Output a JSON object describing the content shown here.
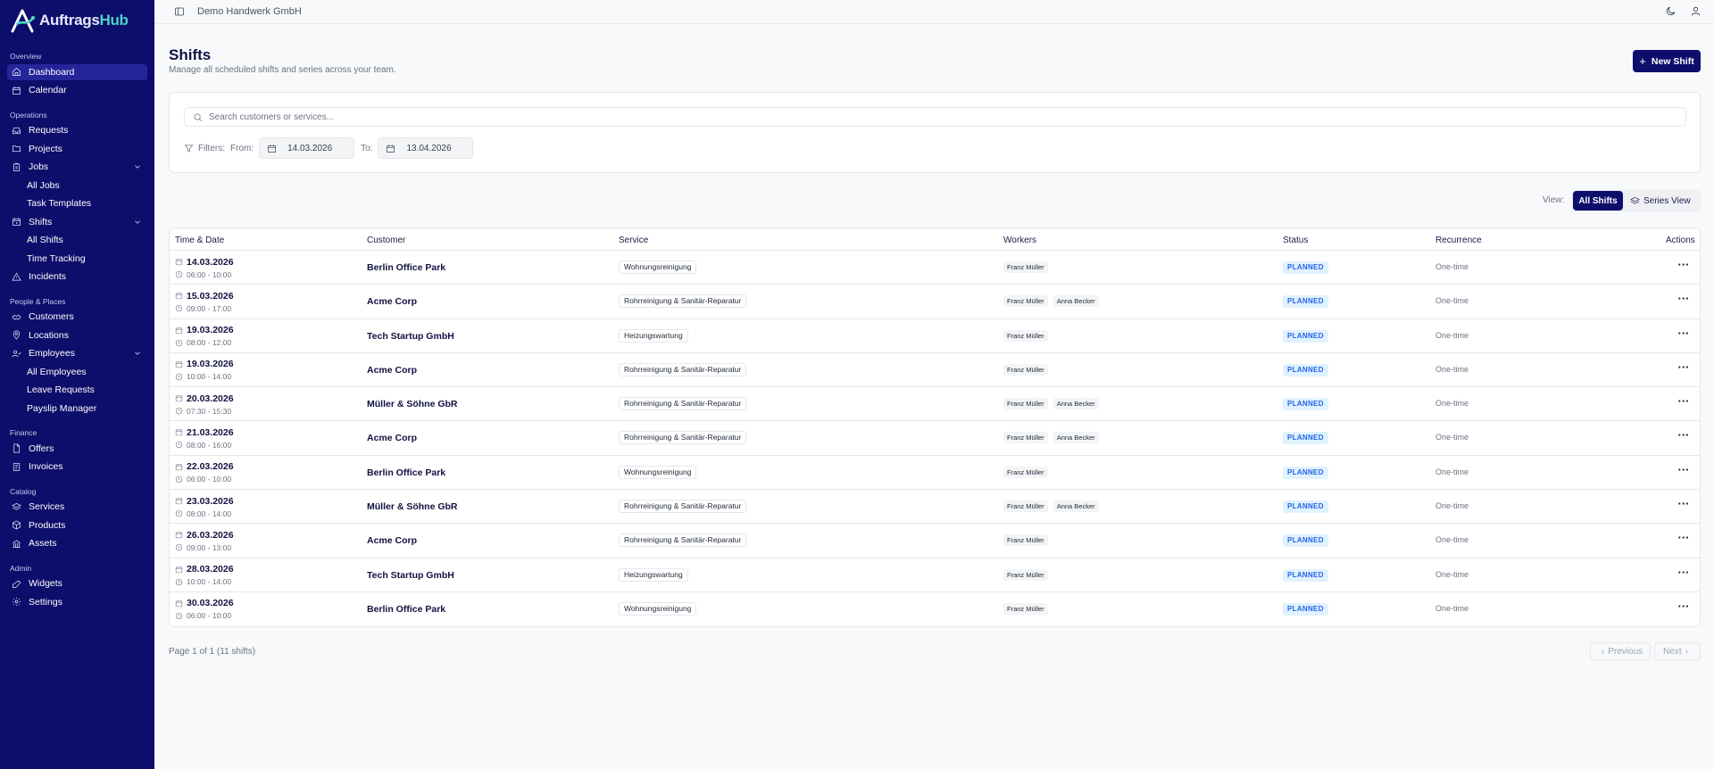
{
  "app": {
    "logo_main": "Auftrags",
    "logo_accent": "Hub",
    "company": "Demo Handwerk GmbH"
  },
  "sidebar": {
    "sections": {
      "overview": "Overview",
      "operations": "Operations",
      "people": "People & Places",
      "finance": "Finance",
      "catalog": "Catalog",
      "admin": "Admin"
    },
    "items": {
      "dashboard": "Dashboard",
      "calendar": "Calendar",
      "requests": "Requests",
      "projects": "Projects",
      "jobs": "Jobs",
      "all_jobs": "All Jobs",
      "task_templates": "Task Templates",
      "shifts": "Shifts",
      "all_shifts": "All Shifts",
      "time_tracking": "Time Tracking",
      "incidents": "Incidents",
      "customers": "Customers",
      "locations": "Locations",
      "employees": "Employees",
      "all_employees": "All Employees",
      "leave_requests": "Leave Requests",
      "payslip_manager": "Payslip Manager",
      "offers": "Offers",
      "invoices": "Invoices",
      "services": "Services",
      "products": "Products",
      "assets": "Assets",
      "widgets": "Widgets",
      "settings": "Settings"
    }
  },
  "header": {
    "title": "Shifts",
    "subtitle": "Manage all scheduled shifts and series across your team.",
    "new_button": "New Shift"
  },
  "filters": {
    "search_placeholder": "Search customers or services...",
    "filters_label": "Filters:",
    "from_label": "From:",
    "from_value": "14.03.2026",
    "to_label": "To:",
    "to_value": "13.04.2026"
  },
  "view": {
    "label": "View:",
    "all_shifts": "All Shifts",
    "series_view": "Series View"
  },
  "table": {
    "headers": {
      "time_date": "Time & Date",
      "customer": "Customer",
      "service": "Service",
      "workers": "Workers",
      "status": "Status",
      "recurrence": "Recurrence",
      "actions": "Actions"
    },
    "rows": [
      {
        "date": "14.03.2026",
        "time": "06:00 - 10:00",
        "customer": "Berlin Office Park",
        "service": "Wohnungsreinigung",
        "worker1": "Franz Müller",
        "worker2": "",
        "status": "PLANNED",
        "recurrence": "One-time"
      },
      {
        "date": "15.03.2026",
        "time": "09:00 - 17:00",
        "customer": "Acme Corp",
        "service": "Rohrreinigung & Sanitär-Reparatur",
        "worker1": "Franz Müller",
        "worker2": "Anna Becker",
        "status": "PLANNED",
        "recurrence": "One-time"
      },
      {
        "date": "19.03.2026",
        "time": "08:00 - 12:00",
        "customer": "Tech Startup GmbH",
        "service": "Heizungswartung",
        "worker1": "Franz Müller",
        "worker2": "",
        "status": "PLANNED",
        "recurrence": "One-time"
      },
      {
        "date": "19.03.2026",
        "time": "10:00 - 14:00",
        "customer": "Acme Corp",
        "service": "Rohrreinigung & Sanitär-Reparatur",
        "worker1": "Franz Müller",
        "worker2": "",
        "status": "PLANNED",
        "recurrence": "One-time"
      },
      {
        "date": "20.03.2026",
        "time": "07:30 - 15:30",
        "customer": "Müller & Söhne GbR",
        "service": "Rohrreinigung & Sanitär-Reparatur",
        "worker1": "Franz Müller",
        "worker2": "Anna Becker",
        "status": "PLANNED",
        "recurrence": "One-time"
      },
      {
        "date": "21.03.2026",
        "time": "08:00 - 16:00",
        "customer": "Acme Corp",
        "service": "Rohrreinigung & Sanitär-Reparatur",
        "worker1": "Franz Müller",
        "worker2": "Anna Becker",
        "status": "PLANNED",
        "recurrence": "One-time"
      },
      {
        "date": "22.03.2026",
        "time": "06:00 - 10:00",
        "customer": "Berlin Office Park",
        "service": "Wohnungsreinigung",
        "worker1": "Franz Müller",
        "worker2": "",
        "status": "PLANNED",
        "recurrence": "One-time"
      },
      {
        "date": "23.03.2026",
        "time": "08:00 - 14:00",
        "customer": "Müller & Söhne GbR",
        "service": "Rohrreinigung & Sanitär-Reparatur",
        "worker1": "Franz Müller",
        "worker2": "Anna Becker",
        "status": "PLANNED",
        "recurrence": "One-time"
      },
      {
        "date": "26.03.2026",
        "time": "09:00 - 13:00",
        "customer": "Acme Corp",
        "service": "Rohrreinigung & Sanitär-Reparatur",
        "worker1": "Franz Müller",
        "worker2": "",
        "status": "PLANNED",
        "recurrence": "One-time"
      },
      {
        "date": "28.03.2026",
        "time": "10:00 - 14:00",
        "customer": "Tech Startup GmbH",
        "service": "Heizungswartung",
        "worker1": "Franz Müller",
        "worker2": "",
        "status": "PLANNED",
        "recurrence": "One-time"
      },
      {
        "date": "30.03.2026",
        "time": "06:00 - 10:00",
        "customer": "Berlin Office Park",
        "service": "Wohnungsreinigung",
        "worker1": "Franz Müller",
        "worker2": "",
        "status": "PLANNED",
        "recurrence": "One-time"
      }
    ]
  },
  "footer": {
    "page_info": "Page 1 of 1 (11 shifts)",
    "previous": "Previous",
    "next": "Next"
  },
  "colors": {
    "sidebar_bg": "#0d0d6b",
    "accent": "#4fd1c5",
    "status_planned_bg": "#e0f2fe",
    "status_planned_text": "#2563eb"
  }
}
